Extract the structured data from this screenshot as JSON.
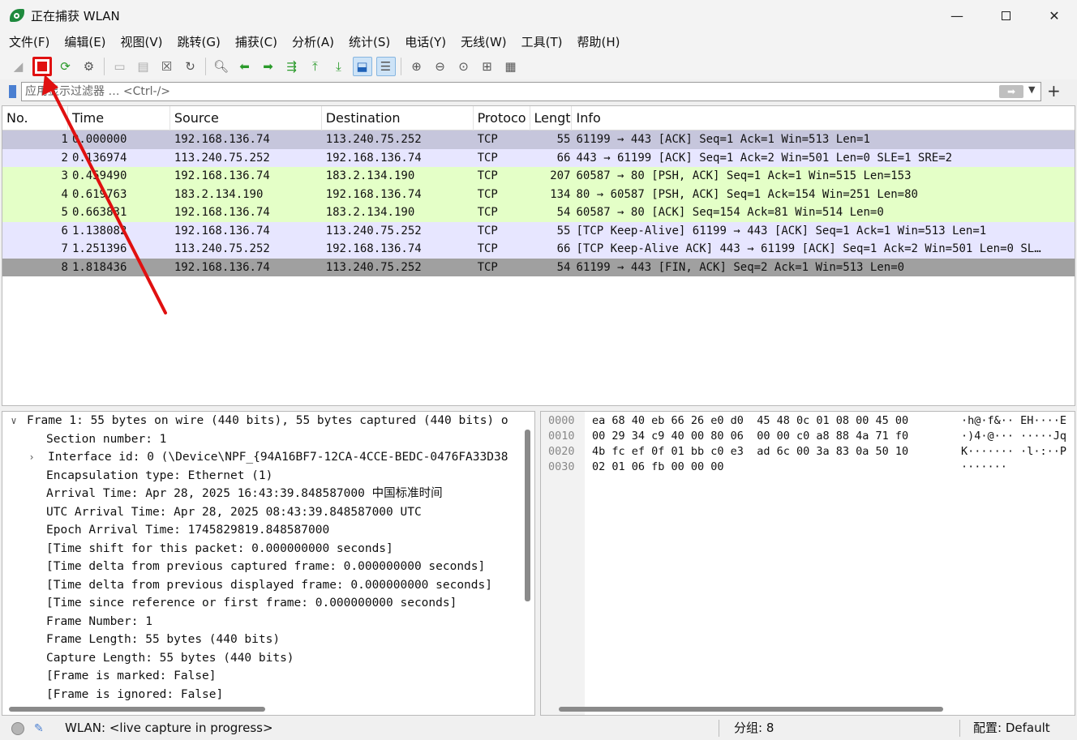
{
  "window": {
    "title": "正在捕获 WLAN",
    "min_symbol": "—",
    "close_symbol": "✕"
  },
  "menu": [
    "文件(F)",
    "编辑(E)",
    "视图(V)",
    "跳转(G)",
    "捕获(C)",
    "分析(A)",
    "统计(S)",
    "电话(Y)",
    "无线(W)",
    "工具(T)",
    "帮助(H)"
  ],
  "filter": {
    "placeholder": "应用显示过滤器 … <Ctrl-/>",
    "apply_symbol": "➡",
    "dropdown_symbol": "▼",
    "add_symbol": "+"
  },
  "packet_list": {
    "columns": [
      "No.",
      "Time",
      "Source",
      "Destination",
      "Protoco",
      "Lengt",
      "Info"
    ],
    "rows": [
      {
        "no": "1",
        "time": "0.000000",
        "src": "192.168.136.74",
        "dst": "113.240.75.252",
        "proto": "TCP",
        "len": "55",
        "info": "61199 → 443 [ACK] Seq=1 Ack=1 Win=513 Len=1"
      },
      {
        "no": "2",
        "time": "0.136974",
        "src": "113.240.75.252",
        "dst": "192.168.136.74",
        "proto": "TCP",
        "len": "66",
        "info": "443 → 61199 [ACK] Seq=1 Ack=2 Win=501 Len=0 SLE=1 SRE=2"
      },
      {
        "no": "3",
        "time": "0.459490",
        "src": "192.168.136.74",
        "dst": "183.2.134.190",
        "proto": "TCP",
        "len": "207",
        "info": "60587 → 80 [PSH, ACK] Seq=1 Ack=1 Win=515 Len=153"
      },
      {
        "no": "4",
        "time": "0.619763",
        "src": "183.2.134.190",
        "dst": "192.168.136.74",
        "proto": "TCP",
        "len": "134",
        "info": "80 → 60587 [PSH, ACK] Seq=1 Ack=154 Win=251 Len=80"
      },
      {
        "no": "5",
        "time": "0.663831",
        "src": "192.168.136.74",
        "dst": "183.2.134.190",
        "proto": "TCP",
        "len": "54",
        "info": "60587 → 80 [ACK] Seq=154 Ack=81 Win=514 Len=0"
      },
      {
        "no": "6",
        "time": "1.138082",
        "src": "192.168.136.74",
        "dst": "113.240.75.252",
        "proto": "TCP",
        "len": "55",
        "info": "[TCP Keep-Alive] 61199 → 443 [ACK] Seq=1 Ack=1 Win=513 Len=1"
      },
      {
        "no": "7",
        "time": "1.251396",
        "src": "113.240.75.252",
        "dst": "192.168.136.74",
        "proto": "TCP",
        "len": "66",
        "info": "[TCP Keep-Alive ACK] 443 → 61199 [ACK] Seq=1 Ack=2 Win=501 Len=0 SL…"
      },
      {
        "no": "8",
        "time": "1.818436",
        "src": "192.168.136.74",
        "dst": "113.240.75.252",
        "proto": "TCP",
        "len": "54",
        "info": "61199 → 443 [FIN, ACK] Seq=2 Ack=1 Win=513 Len=0"
      }
    ]
  },
  "details": {
    "lines": [
      {
        "arrow": "∨",
        "text": "Frame 1: 55 bytes on wire (440 bits), 55 bytes captured (440 bits) o"
      },
      {
        "arrow": "",
        "text": "Section number: 1"
      },
      {
        "arrow": "›",
        "text": "Interface id: 0 (\\Device\\NPF_{94A16BF7-12CA-4CCE-BEDC-0476FA33D38"
      },
      {
        "arrow": "",
        "text": "Encapsulation type: Ethernet (1)"
      },
      {
        "arrow": "",
        "text": "Arrival Time: Apr 28, 2025 16:43:39.848587000 中国标准时间"
      },
      {
        "arrow": "",
        "text": "UTC Arrival Time: Apr 28, 2025 08:43:39.848587000 UTC"
      },
      {
        "arrow": "",
        "text": "Epoch Arrival Time: 1745829819.848587000"
      },
      {
        "arrow": "",
        "text": "[Time shift for this packet: 0.000000000 seconds]"
      },
      {
        "arrow": "",
        "text": "[Time delta from previous captured frame: 0.000000000 seconds]"
      },
      {
        "arrow": "",
        "text": "[Time delta from previous displayed frame: 0.000000000 seconds]"
      },
      {
        "arrow": "",
        "text": "[Time since reference or first frame: 0.000000000 seconds]"
      },
      {
        "arrow": "",
        "text": "Frame Number: 1"
      },
      {
        "arrow": "",
        "text": "Frame Length: 55 bytes (440 bits)"
      },
      {
        "arrow": "",
        "text": "Capture Length: 55 bytes (440 bits)"
      },
      {
        "arrow": "",
        "text": "[Frame is marked: False]"
      },
      {
        "arrow": "",
        "text": "[Frame is ignored: False]"
      }
    ]
  },
  "bytes": {
    "rows": [
      {
        "offset": "0000",
        "hex": "ea 68 40 eb 66 26 e0 d0  45 48 0c 01 08 00 45 00",
        "ascii": "·h@·f&·· EH····E"
      },
      {
        "offset": "0010",
        "hex": "00 29 34 c9 40 00 80 06  00 00 c0 a8 88 4a 71 f0",
        "ascii": "·)4·@··· ·····Jq"
      },
      {
        "offset": "0020",
        "hex": "4b fc ef 0f 01 bb c0 e3  ad 6c 00 3a 83 0a 50 10",
        "ascii": "K······· ·l·:··P"
      },
      {
        "offset": "0030",
        "hex": "02 01 06 fb 00 00 00",
        "ascii": "·······"
      }
    ]
  },
  "status": {
    "capture_text": "WLAN: <live capture in progress>",
    "packets_text": "分组: 8",
    "profile_text": "配置: Default"
  },
  "colors": {
    "accent_stop": "#e01010",
    "row_blue": "#e7e6ff",
    "row_green": "#e4ffc7",
    "row_fin": "#a0a0a0"
  }
}
